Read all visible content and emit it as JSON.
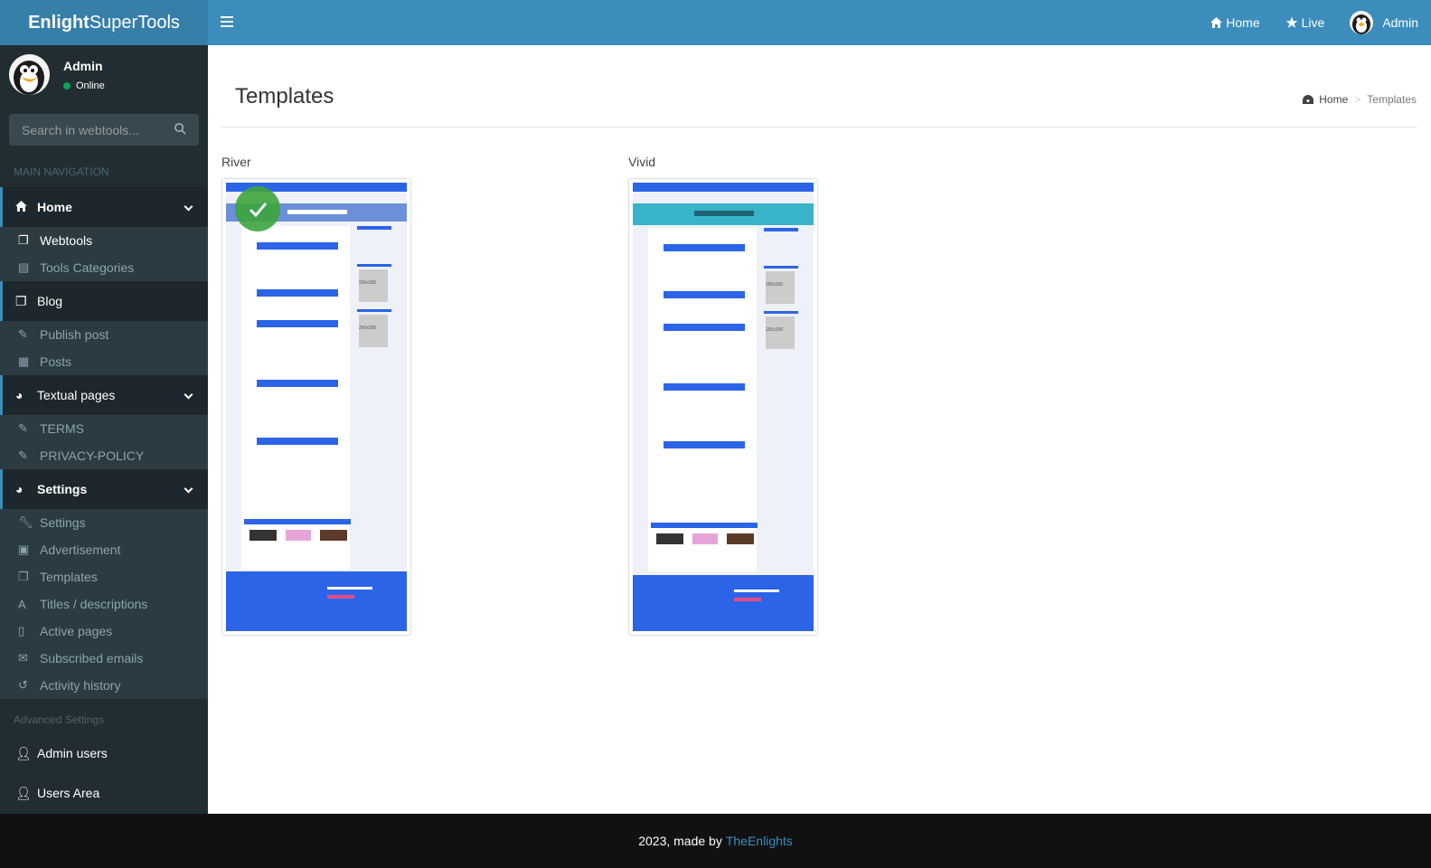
{
  "app": {
    "logo_bold": "Enlight",
    "logo_rest": "SuperTools"
  },
  "topbar": {
    "menu_icon": "hamburger-icon",
    "links": [
      {
        "label": "Home",
        "icon": "home-icon"
      },
      {
        "label": "Live",
        "icon": "star-icon"
      },
      {
        "label": "Admin",
        "icon": "avatar"
      }
    ]
  },
  "user": {
    "name": "Admin",
    "status": "Online",
    "status_color": "#00a65a"
  },
  "search": {
    "placeholder": "Search in webtools...",
    "value": ""
  },
  "sidebar": {
    "main_header": "MAIN NAVIGATION",
    "advanced_header": "Advanced Settings",
    "home": {
      "label": "Home",
      "items": [
        "Webtools",
        "Tools Categories"
      ]
    },
    "blog": {
      "label": "Blog",
      "items": [
        "Publish post",
        "Posts"
      ]
    },
    "textual": {
      "label": "Textual pages",
      "items": [
        "TERMS",
        "PRIVACY-POLICY"
      ]
    },
    "settings": {
      "label": "Settings",
      "items": [
        "Settings",
        "Advertisement",
        "Templates",
        "Titles / descriptions",
        "Active pages",
        "Subscribed emails",
        "Activity history"
      ]
    },
    "admin_users": "Admin users",
    "users_area": "Users Area"
  },
  "page": {
    "title": "Templates",
    "breadcrumb": {
      "home": "Home",
      "separator": ">",
      "current": "Templates"
    }
  },
  "templates": [
    {
      "name": "River",
      "selected": true
    },
    {
      "name": "Vivid",
      "selected": false
    }
  ],
  "thumbnail_text": {
    "ad_box": "250x300"
  },
  "footer": {
    "text": "2023, made by",
    "link": "TheEnlights"
  },
  "colors": {
    "header": "#3c8dbc",
    "logo_bg": "#367fa9",
    "sidebar": "#222d32",
    "accent": "#2c64e8",
    "check": "#3da53d"
  }
}
